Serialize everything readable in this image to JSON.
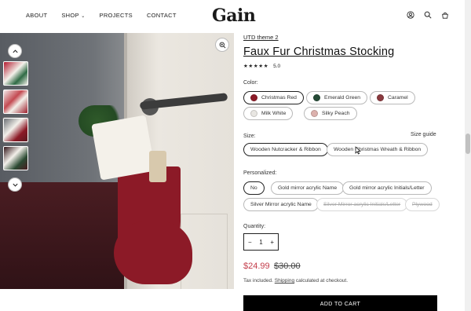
{
  "header": {
    "nav": [
      {
        "label": "ABOUT"
      },
      {
        "label": "SHOP"
      },
      {
        "label": "PROJECTS"
      },
      {
        "label": "CONTACT"
      }
    ],
    "logo": "Gain",
    "icons": [
      "account-icon",
      "search-icon",
      "cart-icon"
    ]
  },
  "product": {
    "vendor": "UTD theme 2",
    "title": "Faux Fur Christmas Stocking",
    "stars": "★★★★★",
    "rating": "5.0",
    "color_label": "Color:",
    "colors": [
      {
        "label": "Christmas Red",
        "swatch": "#8c1a27"
      },
      {
        "label": "Emerald Green",
        "swatch": "#254a36"
      },
      {
        "label": "Caramel",
        "swatch": "#8a3a3f"
      },
      {
        "label": "Milk White",
        "swatch": "#e8e6e2"
      },
      {
        "label": "Silky Peach",
        "swatch": "#dcb1ad"
      }
    ],
    "size_label": "Size:",
    "size_guide": "Size guide",
    "sizes": [
      {
        "label": "Wooden Nutcracker & Ribbon"
      },
      {
        "label": "Wooden Christmas Wreath & Ribbon"
      }
    ],
    "personalized_label": "Personalized:",
    "personalized": [
      {
        "label": "No"
      },
      {
        "label": "Gold mirror acrylic Name"
      },
      {
        "label": "Gold mirror acrylic Initials/Letter"
      },
      {
        "label": "Silver Mirror acrylic Name"
      },
      {
        "label": "Silver Mirror acrylic Initials/Letter"
      },
      {
        "label": "Plywood"
      }
    ],
    "quantity_label": "Quantity:",
    "quantity": "1",
    "price": "$24.99",
    "compare_price": "$30.00",
    "tax_prefix": "Tax included.",
    "tax_link": "Shipping",
    "tax_suffix": "calculated at checkout.",
    "add_to_cart": "ADD TO CART"
  },
  "gallery": {
    "thumb_count": 4,
    "active_thumb": 3
  }
}
